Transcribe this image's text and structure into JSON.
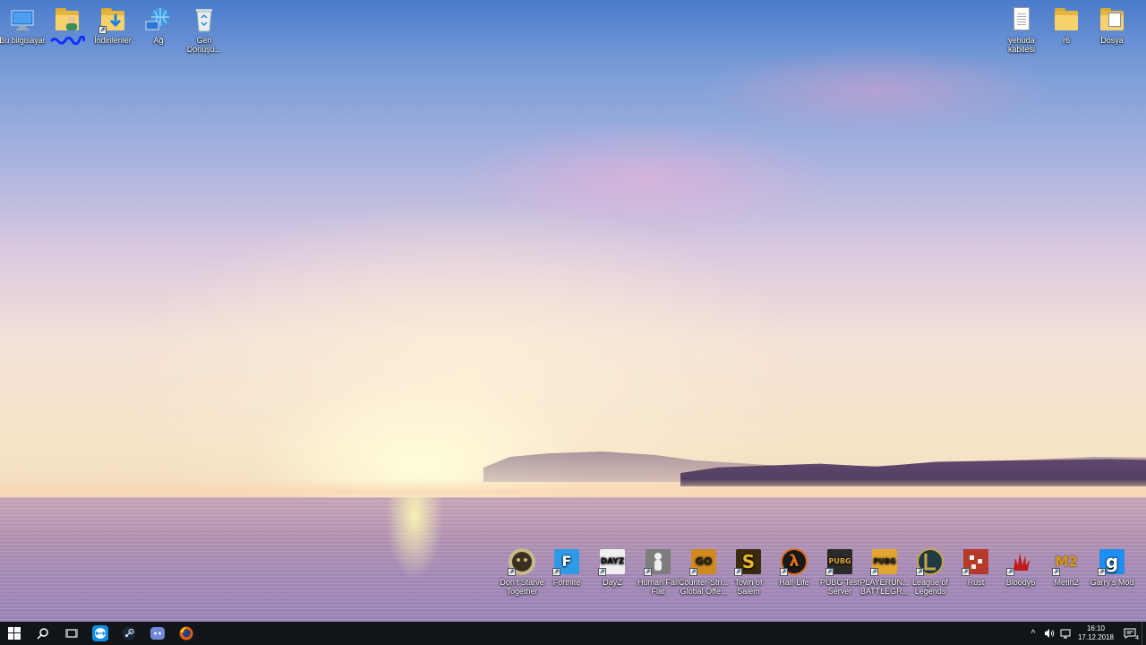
{
  "desktop": {
    "left_icons": [
      {
        "label": "Bu bilgisayar",
        "icon": "computer-icon"
      },
      {
        "label": "",
        "icon": "user-folder-icon"
      },
      {
        "label": "İndirilenler",
        "icon": "downloads-folder-icon"
      },
      {
        "label": "Ağ",
        "icon": "network-icon"
      },
      {
        "label": "Geri Dönüşü...",
        "icon": "recycle-bin-icon"
      }
    ],
    "right_icons": [
      {
        "label": "yehuda kabilesi",
        "icon": "text-document-icon"
      },
      {
        "label": "r6",
        "icon": "folder-icon"
      },
      {
        "label": "Dosya",
        "icon": "folder-icon"
      }
    ],
    "game_icons": [
      {
        "label": "Don't Starve Together",
        "icon": "dont-starve-icon",
        "color": "#3a3020"
      },
      {
        "label": "Fortnite",
        "icon": "fortnite-icon",
        "color": "#2f9ae6"
      },
      {
        "label": "DayZ",
        "icon": "dayz-icon",
        "color": "#222222"
      },
      {
        "label": "Human Fall Flat",
        "icon": "human-fall-flat-icon",
        "color": "#6a6a6a"
      },
      {
        "label": "Counter-Stri... Global Offe...",
        "icon": "csgo-icon",
        "color": "#d08a20"
      },
      {
        "label": "Town of Salem",
        "icon": "town-of-salem-icon",
        "color": "#3a2a10"
      },
      {
        "label": "Half-Life",
        "icon": "half-life-icon",
        "color": "#1a1a1a"
      },
      {
        "label": "PUBG Test Server",
        "icon": "pubg-test-icon",
        "color": "#c8922e"
      },
      {
        "label": "PLAYERUN... BATTLEGR...",
        "icon": "pubg-icon",
        "color": "#e2a531"
      },
      {
        "label": "League of Legends",
        "icon": "league-of-legends-icon",
        "color": "#1f3a44"
      },
      {
        "label": "Rust",
        "icon": "rust-icon",
        "color": "#b63a2a"
      },
      {
        "label": "Bloody6",
        "icon": "bloody-icon",
        "color": "#c21b1b"
      },
      {
        "label": "Metin2",
        "icon": "metin2-icon",
        "color": "#d79a14"
      },
      {
        "label": "Garry's Mod",
        "icon": "garrys-mod-icon",
        "color": "#1e8ef0"
      }
    ],
    "glyphs": {
      "fortnite": "F",
      "dayz": "DAYZ",
      "csgo": "GO",
      "salem": "S",
      "halflife": "λ",
      "pubg": "PUBG",
      "rust": "▪",
      "metin": "M2",
      "gmod": "g"
    }
  },
  "taskbar": {
    "apps": [
      "start-icon",
      "search-icon",
      "task-view-icon",
      "teamviewer-icon",
      "steam-icon",
      "discord-icon",
      "firefox-icon"
    ],
    "tray": {
      "chevron": "^",
      "time": "16:10",
      "date": "17.12.2018",
      "notification_count": "4"
    }
  }
}
